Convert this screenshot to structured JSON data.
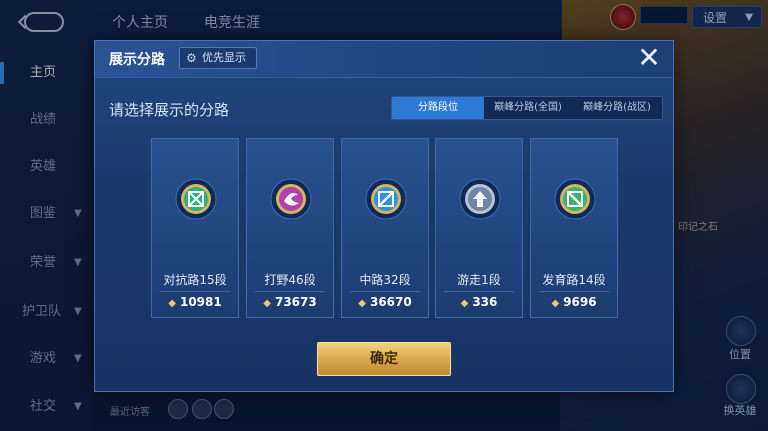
{
  "sidebar": {
    "items": [
      {
        "label": "主页",
        "active": true
      },
      {
        "label": "战绩"
      },
      {
        "label": "英雄"
      },
      {
        "label": "图鉴"
      },
      {
        "label": "荣誉"
      },
      {
        "label": "护卫队"
      },
      {
        "label": "游戏"
      },
      {
        "label": "社交"
      }
    ]
  },
  "header": {
    "tabs": [
      {
        "label": "个人主页"
      },
      {
        "label": "电竞生涯"
      }
    ],
    "settings_label": "设置"
  },
  "right_panel": {
    "side_label": "印记之石",
    "button1_label": "位置",
    "button2_label": "换英雄"
  },
  "bottom": {
    "recent_visitors_label": "最近访客"
  },
  "modal": {
    "title": "展示分路",
    "priority_label": "优先显示",
    "subtitle": "请选择展示的分路",
    "segments": [
      {
        "label": "分路段位",
        "active": true
      },
      {
        "label": "巅峰分路(全国)"
      },
      {
        "label": "巅峰分路(战区)"
      }
    ],
    "cards": [
      {
        "title": "对抗路15段",
        "score": "10981",
        "badge": "top-lane-icon",
        "color": "#2fb07a"
      },
      {
        "title": "打野46段",
        "score": "73673",
        "badge": "jungle-icon",
        "color": "#b23fb0"
      },
      {
        "title": "中路32段",
        "score": "36670",
        "badge": "mid-lane-icon",
        "color": "#2f8fe0"
      },
      {
        "title": "游走1段",
        "score": "336",
        "badge": "roam-icon",
        "color": "#6e85a8"
      },
      {
        "title": "发育路14段",
        "score": "9696",
        "badge": "bot-lane-icon",
        "color": "#3ab074"
      }
    ],
    "confirm_label": "确定"
  },
  "colors": {
    "accent": "#2e7ad6",
    "gold": "#d7a54a"
  }
}
